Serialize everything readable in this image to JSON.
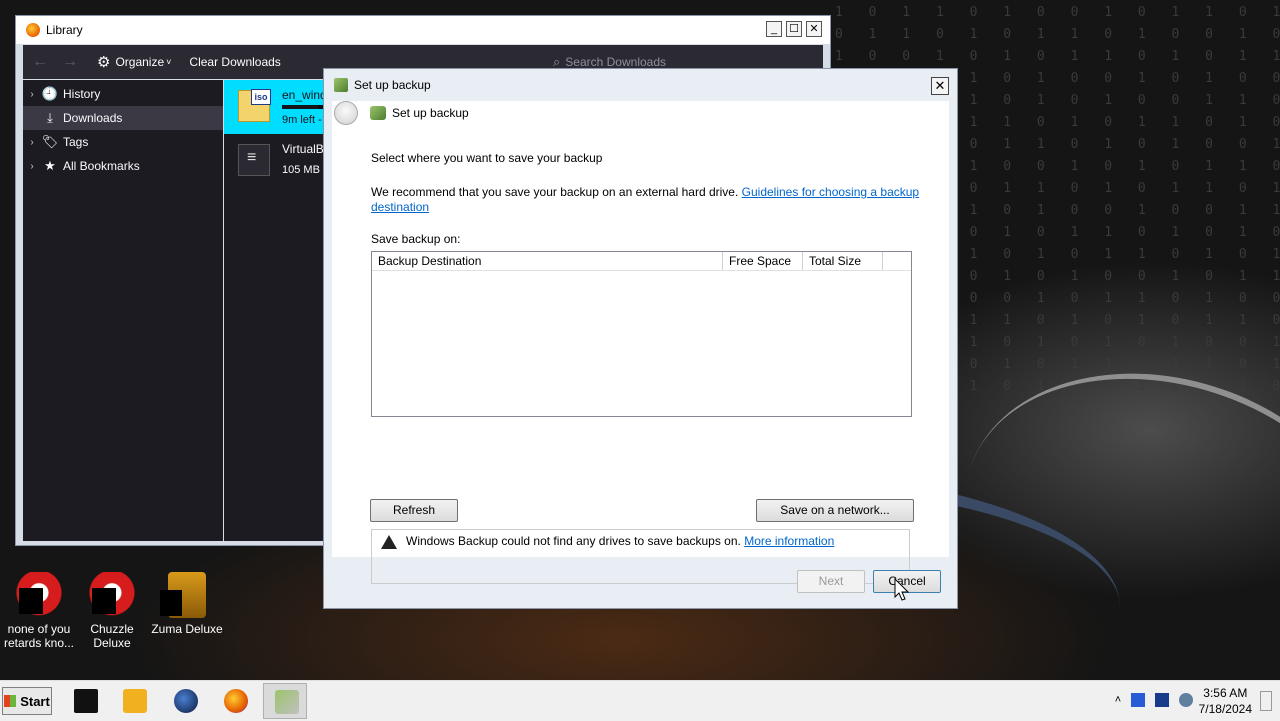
{
  "desktop": {
    "icons": [
      {
        "label": "none of you retards kno...",
        "icon": "red-game-icon"
      },
      {
        "label": "Chuzzle Deluxe",
        "icon": "red-game-icon"
      },
      {
        "label": "Zuma Deluxe",
        "icon": "gold-game-icon"
      }
    ]
  },
  "library": {
    "title": "Library",
    "controls": {
      "minimize": "_",
      "maximize": "☐",
      "close": "✕"
    },
    "toolbar": {
      "organize": "Organize",
      "organize_caret": "˅",
      "clear": "Clear Downloads",
      "search_placeholder": "Search Downloads"
    },
    "sidebar": [
      {
        "label": "History",
        "icon": "🕘",
        "twisty": "›"
      },
      {
        "label": "Downloads",
        "icon": "⤓",
        "twisty": ""
      },
      {
        "label": "Tags",
        "icon": "🏷",
        "twisty": "›"
      },
      {
        "label": "All Bookmarks",
        "icon": "★",
        "twisty": "›"
      }
    ],
    "downloads": [
      {
        "name": "en_wind",
        "status": "9m left -",
        "progress": 0.6
      },
      {
        "name": "VirtualB",
        "status": "105 MB"
      }
    ]
  },
  "backup": {
    "title": "Set up backup",
    "header": "Set up backup",
    "close": "✕",
    "heading": "Select where you want to save your backup",
    "recommend": "We recommend that you save your backup on an external hard drive.",
    "guidelines_link": "Guidelines for choosing a backup destination",
    "save_on_label": "Save backup on:",
    "columns": [
      "Backup Destination",
      "Free Space",
      "Total Size"
    ],
    "refresh": "Refresh",
    "save_network": "Save on a network...",
    "warning": "Windows Backup could not find any drives to save backups on.",
    "more_info": "More information",
    "next": "Next",
    "cancel": "Cancel"
  },
  "taskbar": {
    "start": "Start",
    "apps": [
      "terminal-icon",
      "media-player-icon",
      "globe-icon",
      "firefox-icon",
      "backup-app-icon"
    ],
    "tray_arrow": "˄",
    "time": "3:56 AM",
    "date": "7/18/2024"
  }
}
